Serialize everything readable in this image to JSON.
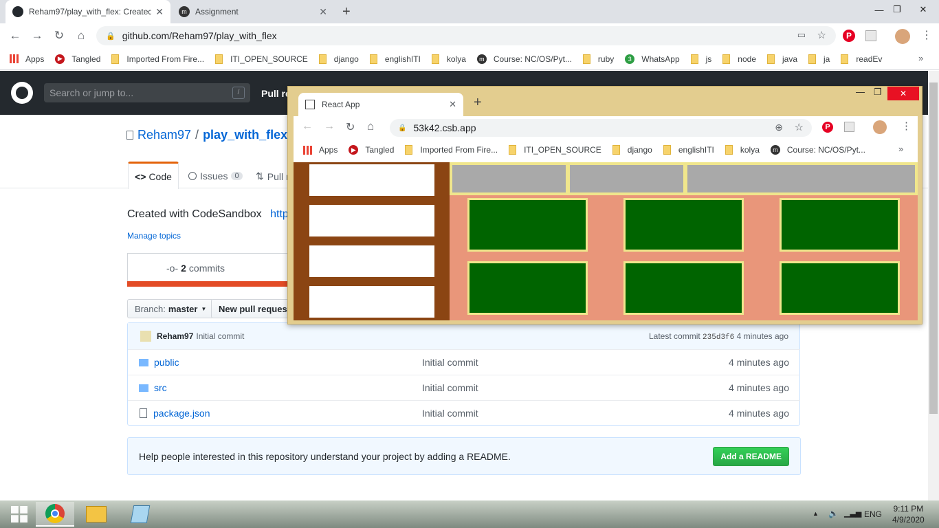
{
  "browser": {
    "tabs": [
      {
        "title": "Reham97/play_with_flex: Created with CodeSandbox",
        "active": true
      },
      {
        "title": "Assignment",
        "active": false
      }
    ],
    "url": "github.com/Reham97/play_with_flex",
    "bookmarks": [
      "Apps",
      "Tangled",
      "Imported From Fire...",
      "ITI_OPEN_SOURCE",
      "django",
      "englishITI",
      "kolya",
      "Course: NC/OS/Pyt...",
      "ruby",
      "WhatsApp",
      "js",
      "node",
      "java",
      "ja",
      "readEv"
    ]
  },
  "github": {
    "search_placeholder": "Search or jump to...",
    "search_hint": "/",
    "nav_pull": "Pull re",
    "owner": "Reham97",
    "separator": "/",
    "repo": "play_with_flex",
    "tab_code": "Code",
    "tab_issues": "Issues",
    "issues_count": "0",
    "tab_pull": "Pull r",
    "description": "Created with CodeSandbox",
    "description_link": "http",
    "manage_topics": "Manage topics",
    "commits_count": "2",
    "commits_label": "commits",
    "branch_label": "Branch:",
    "branch_value": "master",
    "new_pr": "New pull request",
    "last_commit_author": "Reham97",
    "last_commit_msg": "Initial commit",
    "latest_commit_label": "Latest commit",
    "latest_commit_sha": "235d3f6",
    "latest_commit_time": "4 minutes ago",
    "files": [
      {
        "name": "public",
        "type": "folder",
        "msg": "Initial commit",
        "time": "4 minutes ago"
      },
      {
        "name": "src",
        "type": "folder",
        "msg": "Initial commit",
        "time": "4 minutes ago"
      },
      {
        "name": "package.json",
        "type": "file",
        "msg": "Initial commit",
        "time": "4 minutes ago"
      }
    ],
    "readme_text": "Help people interested in this repository understand your project by adding a README.",
    "readme_button": "Add a README"
  },
  "inner_window": {
    "tab_title": "React App",
    "url": "53k42.csb.app",
    "bookmarks": [
      "Apps",
      "Tangled",
      "Imported From Fire...",
      "ITI_OPEN_SOURCE",
      "django",
      "englishITI",
      "kolya",
      "Course: NC/OS/Pyt..."
    ]
  },
  "taskbar": {
    "lang": "ENG",
    "time": "9:11 PM",
    "date": "4/9/2020"
  },
  "colors": {
    "sidebar": "#8b4513",
    "grid_bg": "#e9967a",
    "box": "#006400",
    "box_border": "#f0e68c",
    "top_cell": "#a9a9a9",
    "window_frame": "#e3cd8f"
  }
}
